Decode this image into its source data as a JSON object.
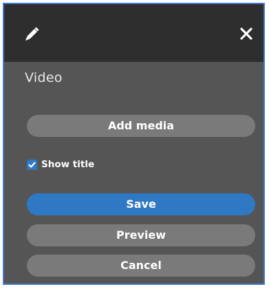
{
  "header": {
    "edit_icon": "pencil-icon",
    "close_icon": "close-icon"
  },
  "panel": {
    "title": "Video",
    "add_media_label": "Add media",
    "show_title": {
      "label": "Show title",
      "checked": true
    },
    "save_label": "Save",
    "preview_label": "Preview",
    "cancel_label": "Cancel"
  },
  "colors": {
    "header_bg": "#2e2e2e",
    "panel_bg": "#555555",
    "button_bg": "#7a7a7a",
    "primary": "#2f78c4",
    "border": "#3c7bd0"
  }
}
